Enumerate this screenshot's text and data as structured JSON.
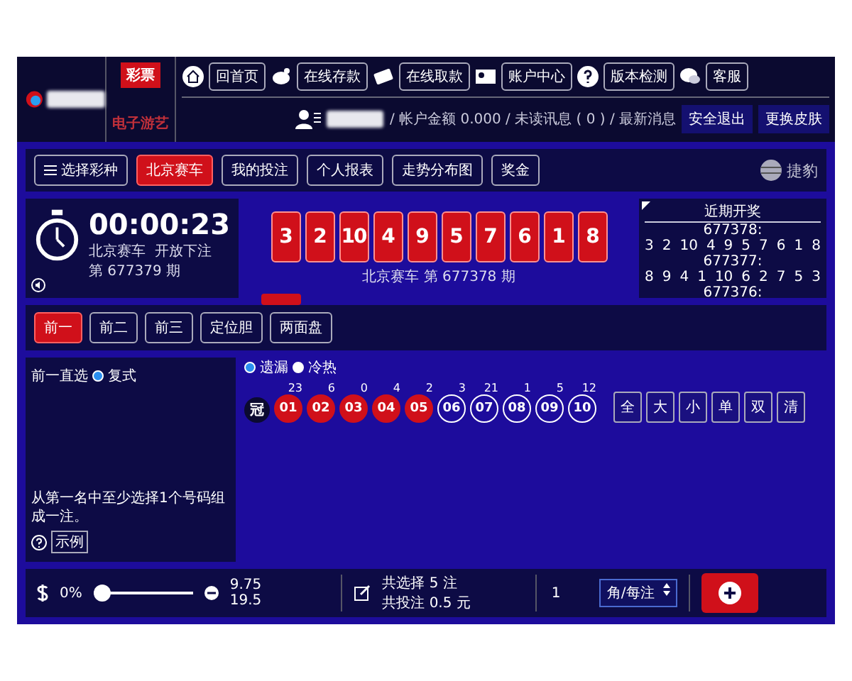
{
  "header": {
    "categories": [
      {
        "label": "彩票",
        "selected": true
      },
      {
        "label": "电子游艺",
        "selected": false
      }
    ],
    "nav": [
      {
        "label": "回首页",
        "kind": "home"
      },
      {
        "label": "在线存款",
        "kind": "deposit"
      },
      {
        "label": "在线取款",
        "kind": "withdraw"
      },
      {
        "label": "账户中心",
        "kind": "account"
      },
      {
        "label": "版本检测",
        "kind": "check"
      },
      {
        "label": "客服",
        "kind": "service"
      }
    ],
    "account": {
      "text": "/ 帐户金额 0.000 / 未读讯息 ( 0 ) / 最新消息",
      "buttons": [
        "安全退出",
        "更换皮肤"
      ]
    }
  },
  "toolbar": {
    "menu": "选择彩种",
    "tabs": [
      {
        "label": "北京赛车",
        "selected": true
      },
      {
        "label": "我的投注",
        "selected": false
      },
      {
        "label": "个人报表",
        "selected": false
      },
      {
        "label": "走势分布图",
        "selected": false
      },
      {
        "label": "奖金",
        "selected": false
      }
    ],
    "brand": "捷豹"
  },
  "timer": {
    "time": "00:00:23",
    "status": "北京赛车  开放下注",
    "issue": "第 677379 期"
  },
  "result": {
    "numbers": [
      "3",
      "2",
      "10",
      "4",
      "9",
      "5",
      "7",
      "6",
      "1",
      "8"
    ],
    "caption": "北京赛车 第 677378 期"
  },
  "recent": {
    "title": "近期开奖",
    "draws": [
      {
        "issue": "677378:",
        "numbers": [
          "3",
          "2",
          "10",
          "4",
          "9",
          "5",
          "7",
          "6",
          "1",
          "8"
        ]
      },
      {
        "issue": "677377:",
        "numbers": [
          "8",
          "9",
          "4",
          "1",
          "10",
          "6",
          "2",
          "7",
          "5",
          "3"
        ]
      },
      {
        "issue": "677376:"
      }
    ]
  },
  "play_tabs": [
    {
      "label": "前一",
      "selected": true
    },
    {
      "label": "前二",
      "selected": false
    },
    {
      "label": "前三",
      "selected": false
    },
    {
      "label": "定位胆",
      "selected": false
    },
    {
      "label": "两面盘",
      "selected": false
    }
  ],
  "bet": {
    "play_name": "前一直选",
    "modes": [
      {
        "label": "复式",
        "selected": true
      }
    ],
    "hint": "从第一名中至少选择1个号码组成一注。",
    "example": "示例",
    "views": [
      {
        "label": "遗漏",
        "selected": true
      },
      {
        "label": "冷热",
        "selected": false
      }
    ],
    "row_label": "冠",
    "balls": [
      {
        "number": "01",
        "miss": "23",
        "selected": true
      },
      {
        "number": "02",
        "miss": "6",
        "selected": true
      },
      {
        "number": "03",
        "miss": "0",
        "selected": true
      },
      {
        "number": "04",
        "miss": "4",
        "selected": true
      },
      {
        "number": "05",
        "miss": "2",
        "selected": true
      },
      {
        "number": "06",
        "miss": "3",
        "selected": false
      },
      {
        "number": "07",
        "miss": "21",
        "selected": false
      },
      {
        "number": "08",
        "miss": "1",
        "selected": false
      },
      {
        "number": "09",
        "miss": "5",
        "selected": false
      },
      {
        "number": "10",
        "miss": "12",
        "selected": false
      }
    ],
    "quick": [
      "全",
      "大",
      "小",
      "单",
      "双",
      "清"
    ]
  },
  "footer": {
    "rebate": "0%",
    "slider": {
      "level": 0
    },
    "odds": [
      "9.75",
      "19.5"
    ],
    "summary": [
      "共选择 5 注",
      "共投注 0.5 元"
    ],
    "multiple": "1",
    "unit": "角/每注"
  }
}
